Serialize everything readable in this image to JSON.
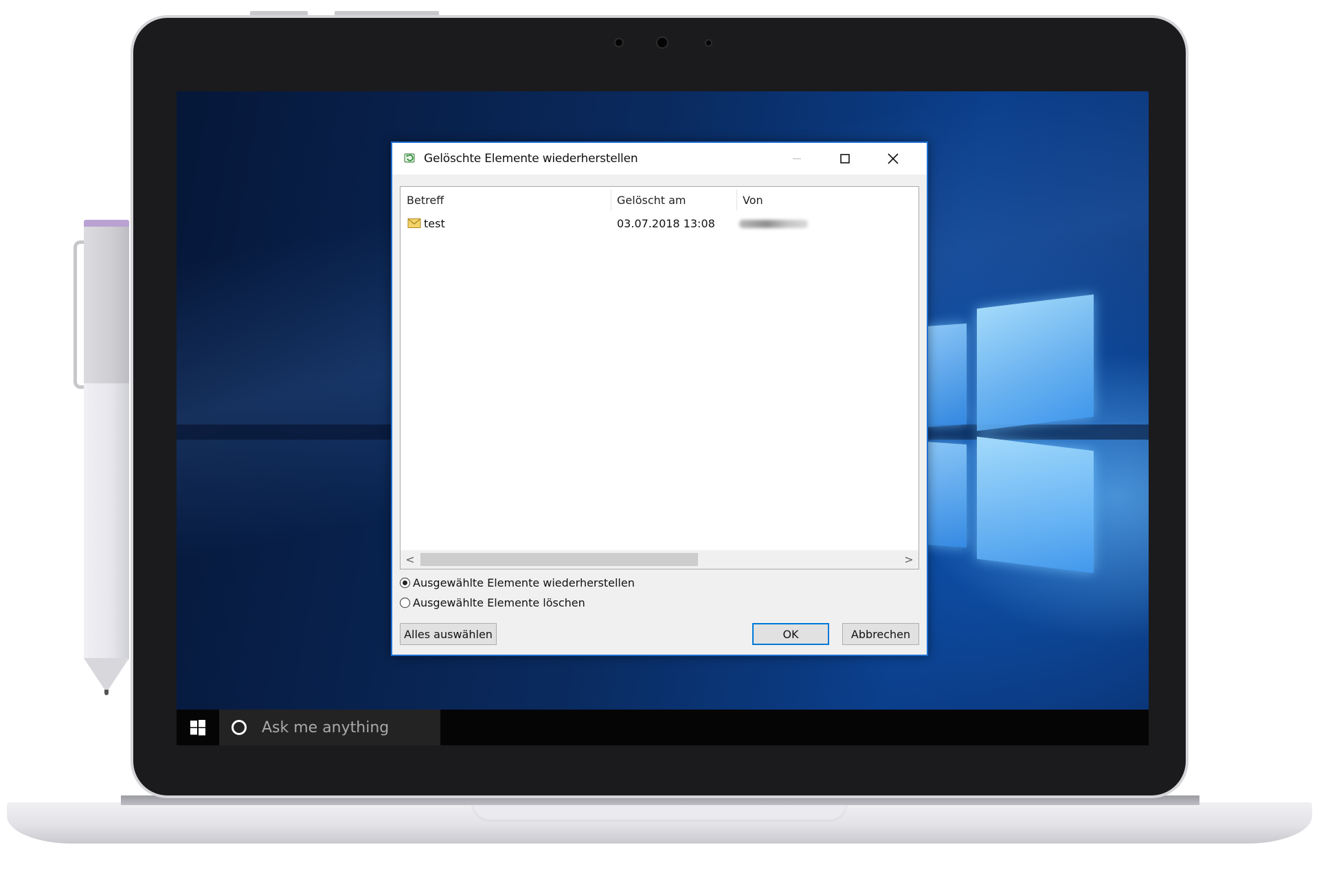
{
  "dialog": {
    "title": "Gelöschte Elemente wiederherstellen",
    "columns": [
      "Betreff",
      "Gelöscht am",
      "Von"
    ],
    "rows": [
      {
        "subject": "test",
        "deleted_at": "03.07.2018 13:08"
      }
    ],
    "scroll": {
      "left_arrow": "<",
      "right_arrow": ">"
    },
    "options": {
      "restore_label": "Ausgewählte Elemente wiederherstellen",
      "delete_label": "Ausgewählte Elemente löschen",
      "selected": "restore"
    },
    "buttons": {
      "select_all": "Alles auswählen",
      "ok": "OK",
      "cancel": "Abbrechen"
    }
  },
  "taskbar": {
    "search_placeholder": "Ask me anything"
  },
  "colors": {
    "dialog_border": "#1e6fd0",
    "taskbar": "#050505",
    "desktop_blue": "#0b3f8c"
  },
  "icons": [
    "restore-icon",
    "minimize-icon",
    "maximize-icon",
    "close-icon",
    "envelope-icon",
    "windows-logo-icon",
    "cortana-icon"
  ]
}
